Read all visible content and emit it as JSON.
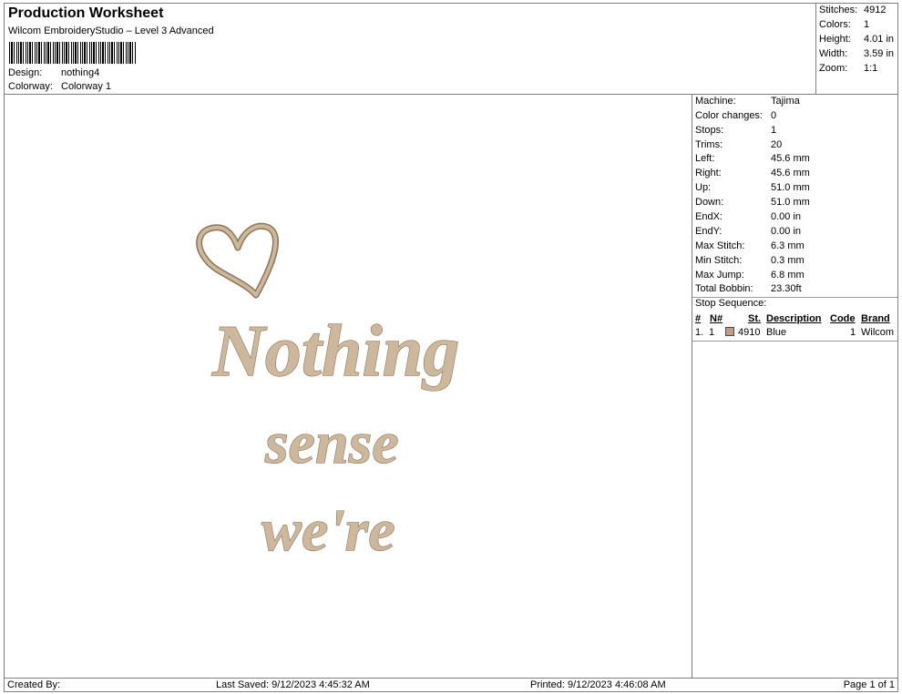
{
  "header": {
    "title": "Production Worksheet",
    "subtitle": "Wilcom EmbroideryStudio – Level 3 Advanced",
    "design_label": "Design:",
    "design_value": "nothing4",
    "colorway_label": "Colorway:",
    "colorway_value": "Colorway 1"
  },
  "summary": [
    {
      "label": "Stitches:",
      "value": "4912"
    },
    {
      "label": "Colors:",
      "value": "1"
    },
    {
      "label": "Height:",
      "value": "4.01 in"
    },
    {
      "label": "Width:",
      "value": "3.59 in"
    },
    {
      "label": "Zoom:",
      "value": "1:1"
    }
  ],
  "design": {
    "lines": [
      "Nothing",
      "sense",
      "we're"
    ],
    "thread_color": "#cdb79d",
    "outline_color": "#8c7558",
    "motif_icon": "heart-icon"
  },
  "details": [
    {
      "label": "Machine:",
      "value": "Tajima"
    },
    {
      "label": "Color changes:",
      "value": "0"
    },
    {
      "label": "Stops:",
      "value": "1"
    },
    {
      "label": "Trims:",
      "value": "20"
    },
    {
      "label": "Left:",
      "value": "45.6 mm"
    },
    {
      "label": "Right:",
      "value": "45.6 mm"
    },
    {
      "label": "Up:",
      "value": "51.0 mm"
    },
    {
      "label": "Down:",
      "value": "51.0 mm"
    },
    {
      "label": "EndX:",
      "value": "0.00 in"
    },
    {
      "label": "EndY:",
      "value": "0.00 in"
    },
    {
      "label": "Max Stitch:",
      "value": "6.3 mm"
    },
    {
      "label": "Min Stitch:",
      "value": "0.3 mm"
    },
    {
      "label": "Max Jump:",
      "value": "6.8 mm"
    },
    {
      "label": "Total Bobbin:",
      "value": "23.30ft"
    }
  ],
  "stop_sequence": {
    "title": "Stop Sequence:",
    "columns": [
      "#",
      "N#",
      "St.",
      "Description",
      "Code",
      "Brand"
    ],
    "rows": [
      {
        "index": "1.",
        "n": "1",
        "swatch_color": "#c49a86",
        "stitches": "4910",
        "description": "Blue",
        "code": "1",
        "brand": "Wilcom"
      }
    ]
  },
  "footer": {
    "created_by": "Created By:",
    "last_saved": "Last Saved: 9/12/2023 4:45:32 AM",
    "printed": "Printed: 9/12/2023 4:46:08 AM",
    "page": "Page 1 of 1"
  }
}
